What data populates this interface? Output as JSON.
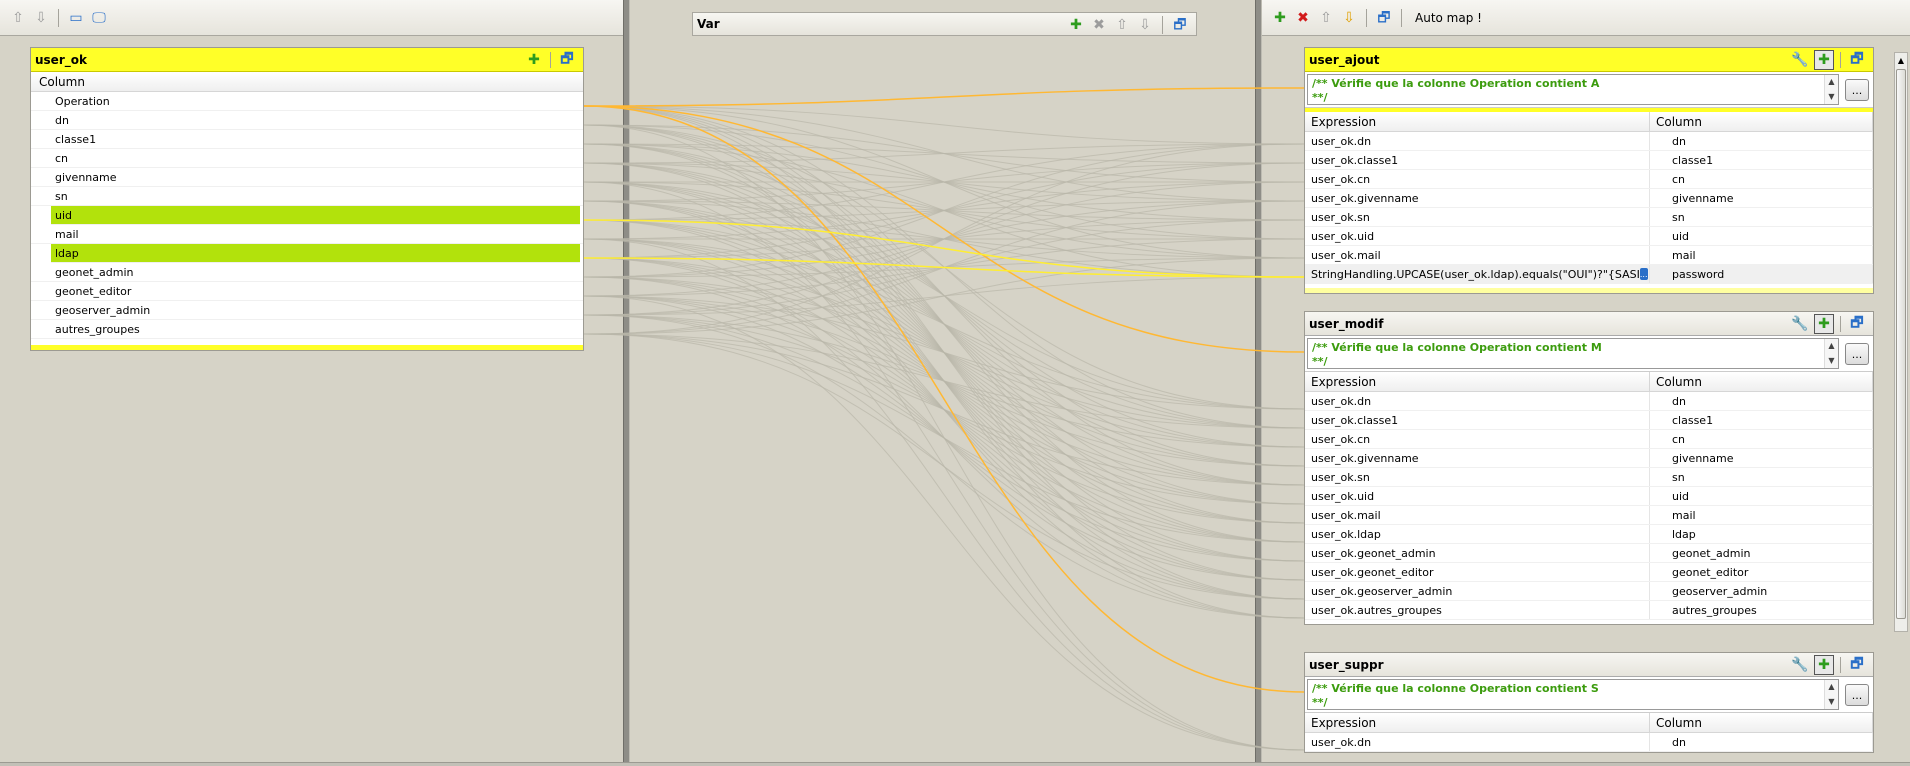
{
  "left": {
    "toolbar": {
      "icons": [
        "arrow-up-icon",
        "arrow-down-icon",
        "window-icon",
        "monitor-icon"
      ]
    },
    "table": {
      "title": "user_ok",
      "column_header": "Column",
      "rows": [
        "Operation",
        "dn",
        "classe1",
        "cn",
        "givenname",
        "sn",
        "uid",
        "mail",
        "ldap",
        "geonet_admin",
        "geonet_editor",
        "geoserver_admin",
        "autres_groupes"
      ],
      "selected_rows": [
        "uid",
        "ldap"
      ]
    }
  },
  "middle": {
    "var_title": "Var"
  },
  "right": {
    "toolbar": {
      "auto_map_label": "Auto map !"
    },
    "dots_label": "...",
    "tables": [
      {
        "title": "user_ajout",
        "filter_line1": "/** Vérifie que la colonne Operation contient A",
        "filter_line2": "**/",
        "expression_header": "Expression",
        "column_header": "Column",
        "rows": [
          {
            "expr": "user_ok.dn",
            "col": "dn"
          },
          {
            "expr": "user_ok.classe1",
            "col": "classe1"
          },
          {
            "expr": "user_ok.cn",
            "col": "cn"
          },
          {
            "expr": "user_ok.givenname",
            "col": "givenname"
          },
          {
            "expr": "user_ok.sn",
            "col": "sn"
          },
          {
            "expr": "user_ok.uid",
            "col": "uid"
          },
          {
            "expr": "user_ok.mail",
            "col": "mail"
          },
          {
            "expr": "StringHandling.UPCASE(user_ok.ldap).equals(\"OUI\")?\"{SASI",
            "col": "password"
          }
        ]
      },
      {
        "title": "user_modif",
        "filter_line1": "/** Vérifie que la colonne Operation contient M",
        "filter_line2": "**/",
        "expression_header": "Expression",
        "column_header": "Column",
        "rows": [
          {
            "expr": "user_ok.dn",
            "col": "dn"
          },
          {
            "expr": "user_ok.classe1",
            "col": "classe1"
          },
          {
            "expr": "user_ok.cn",
            "col": "cn"
          },
          {
            "expr": "user_ok.givenname",
            "col": "givenname"
          },
          {
            "expr": "user_ok.sn",
            "col": "sn"
          },
          {
            "expr": "user_ok.uid",
            "col": "uid"
          },
          {
            "expr": "user_ok.mail",
            "col": "mail"
          },
          {
            "expr": "user_ok.ldap",
            "col": "ldap"
          },
          {
            "expr": "user_ok.geonet_admin",
            "col": "geonet_admin"
          },
          {
            "expr": "user_ok.geonet_editor",
            "col": "geonet_editor"
          },
          {
            "expr": "user_ok.geoserver_admin",
            "col": "geoserver_admin"
          },
          {
            "expr": "user_ok.autres_groupes",
            "col": "autres_groupes"
          }
        ]
      },
      {
        "title": "user_suppr",
        "filter_line1": "/** Vérifie que la colonne Operation contient S",
        "filter_line2": "**/",
        "expression_header": "Expression",
        "column_header": "Column",
        "rows": [
          {
            "expr": "user_ok.dn",
            "col": "dn"
          }
        ]
      }
    ]
  },
  "colors": {
    "header_yellow": "#ffff28",
    "selection_green": "#b2e20c",
    "link_orange": "#ffb833",
    "link_yellow": "#ffee33",
    "filter_green": "#3c9c0e"
  }
}
